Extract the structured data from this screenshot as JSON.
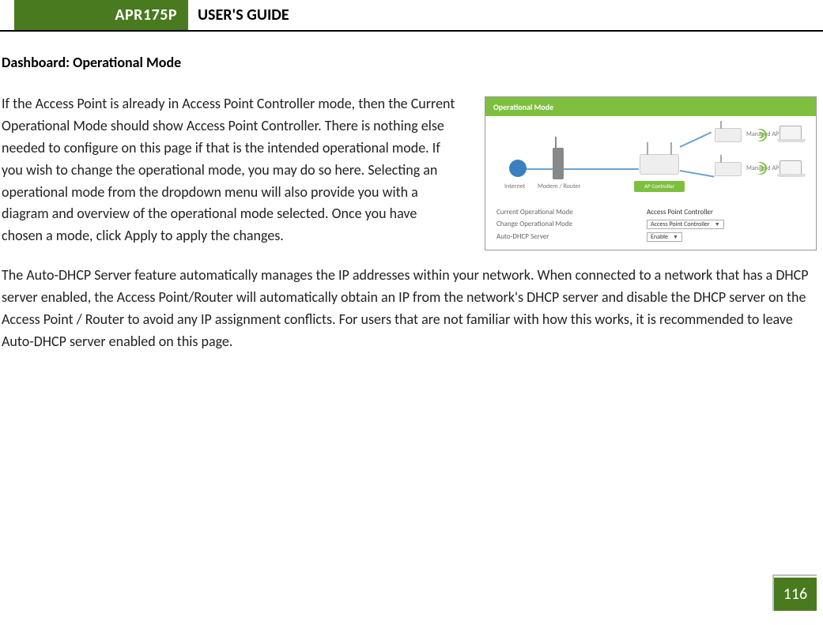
{
  "header": {
    "model": "APR175P",
    "title": "USER'S GUIDE"
  },
  "section_title": "Dashboard: Operational Mode",
  "paragraph1": "If the Access Point is already in Access Point Controller mode, then the Current Operational Mode should show Access Point Controller.  There is nothing else needed to configure on this page if that is the intended operational mode.  If you wish to change the operational mode, you may do so here.  Selecting an operational mode from the dropdown menu will also provide you with a diagram and overview of the operational mode selected.  Once you have chosen a mode, click Apply to apply the changes.",
  "paragraph2": "The Auto-DHCP Server feature automatically manages the IP addresses within your network.  When connected to a network that has a DHCP server enabled, the Access Point/Router will automatically obtain an IP from the network's DHCP server and disable the DHCP server on the Access Point / Router to avoid any IP assignment conflicts. For users that are not familiar with how this works, it is recommended to leave Auto-DHCP server enabled on this page.",
  "figure": {
    "banner": "Operational Mode",
    "internet_label": "Internet",
    "modem_router_label": "Modem / Router",
    "ap_controller_badge": "AP Controller",
    "managed_ap_label": "Managed AP",
    "rows": {
      "r1_label": "Current Operational Mode",
      "r1_value": "Access Point Controller",
      "r2_label": "Change Operational Mode",
      "r2_value": "Access Point Controller",
      "r3_label": "Auto-DHCP Server",
      "r3_value": "Enable"
    }
  },
  "page_number": "116"
}
